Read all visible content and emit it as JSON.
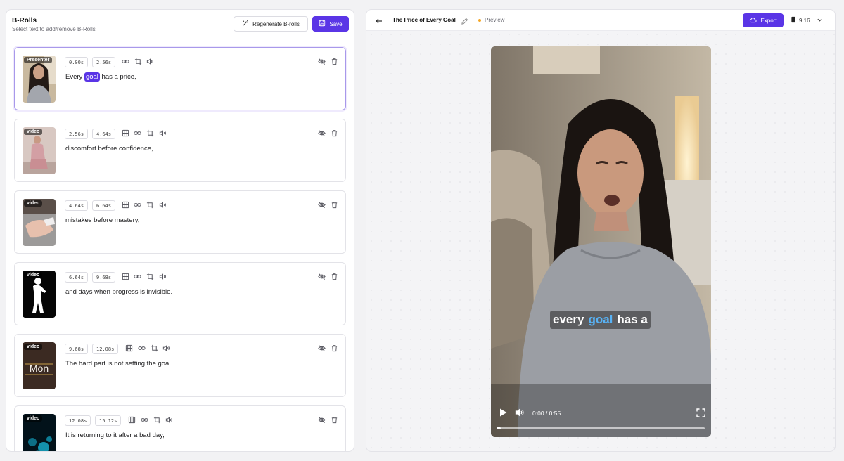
{
  "colors": {
    "accent": "#5a35e6",
    "highlight_caption": "#58b2f5",
    "status_dot": "#f5a623"
  },
  "broll_panel": {
    "title": "B-Rolls",
    "subtitle": "Select text to add/remove B-Rolls",
    "regenerate_label": "Regenerate B-rolls",
    "save_label": "Save"
  },
  "clips": [
    {
      "tag": "Presenter",
      "start": "0.00s",
      "end": "2.56s",
      "text_before": "Every ",
      "highlight": "goal",
      "text_after": " has a price,",
      "selected": true,
      "icons": [
        "link-icon",
        "crop-icon",
        "volume-icon"
      ]
    },
    {
      "tag": "video",
      "start": "2.56s",
      "end": "4.64s",
      "text": "discomfort before confidence,",
      "icons": [
        "film-icon",
        "link-icon",
        "crop-icon",
        "volume-icon"
      ]
    },
    {
      "tag": "video",
      "start": "4.64s",
      "end": "6.64s",
      "text": "mistakes before mastery,",
      "icons": [
        "film-icon",
        "link-icon",
        "crop-icon",
        "volume-icon"
      ]
    },
    {
      "tag": "video",
      "start": "6.64s",
      "end": "9.68s",
      "text": "and days when progress is invisible.",
      "icons": [
        "film-icon",
        "link-icon",
        "crop-icon",
        "volume-icon"
      ]
    },
    {
      "tag": "video",
      "thumb_text": "Mon",
      "start": "9.68s",
      "end": "12.08s",
      "text": "The hard part is not setting the goal.",
      "icons": [
        "film-icon",
        "link-icon",
        "crop-icon",
        "volume-icon"
      ]
    },
    {
      "tag": "video",
      "start": "12.08s",
      "end": "15.12s",
      "text": "It is returning to it after a bad day,",
      "icons": [
        "film-icon",
        "link-icon",
        "crop-icon",
        "volume-icon"
      ]
    }
  ],
  "preview_panel": {
    "project_title": "The Price of Every Goal",
    "status": "Preview",
    "export_label": "Export",
    "aspect_ratio": "9:16"
  },
  "video": {
    "caption_before": "every",
    "caption_highlight": "goal",
    "caption_after": "has a",
    "time": "0:00 / 0:55",
    "progress": 0.02
  }
}
